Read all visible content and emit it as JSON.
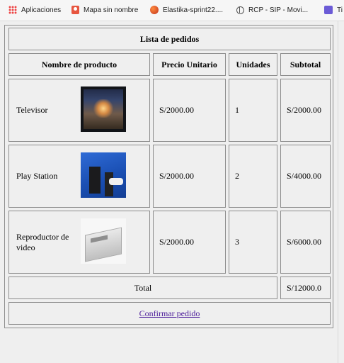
{
  "bookmarks": [
    {
      "label": "Aplicaciones",
      "icon": "apps-icon"
    },
    {
      "label": "Mapa sin nombre",
      "icon": "map-icon"
    },
    {
      "label": "Elastika-sprint22....",
      "icon": "elastika-icon"
    },
    {
      "label": "RCP - SIP - Movi...",
      "icon": "globe-icon"
    },
    {
      "label": "Ti",
      "icon": "list-icon"
    }
  ],
  "table": {
    "title": "Lista de pedidos",
    "headers": [
      "Nombre de producto",
      "Precio Unitario",
      "Unidades",
      "Subtotal"
    ],
    "rows": [
      {
        "name": "Televisor",
        "price": "S/2000.00",
        "units": "1",
        "subtotal": "S/2000.00",
        "image_icon": "television-image"
      },
      {
        "name": "Play Station",
        "price": "S/2000.00",
        "units": "2",
        "subtotal": "S/4000.00",
        "image_icon": "playstation-image"
      },
      {
        "name": "Reproductor de video",
        "price": "S/2000.00",
        "units": "3",
        "subtotal": "S/6000.00",
        "image_icon": "video-player-image"
      }
    ],
    "total_label": "Total",
    "total_value": "S/12000.0",
    "confirm_link": "Confirmar pedido"
  },
  "colors": {
    "border": "#8d8d8d",
    "link": "#4b1b9a",
    "background": "#efefef"
  }
}
